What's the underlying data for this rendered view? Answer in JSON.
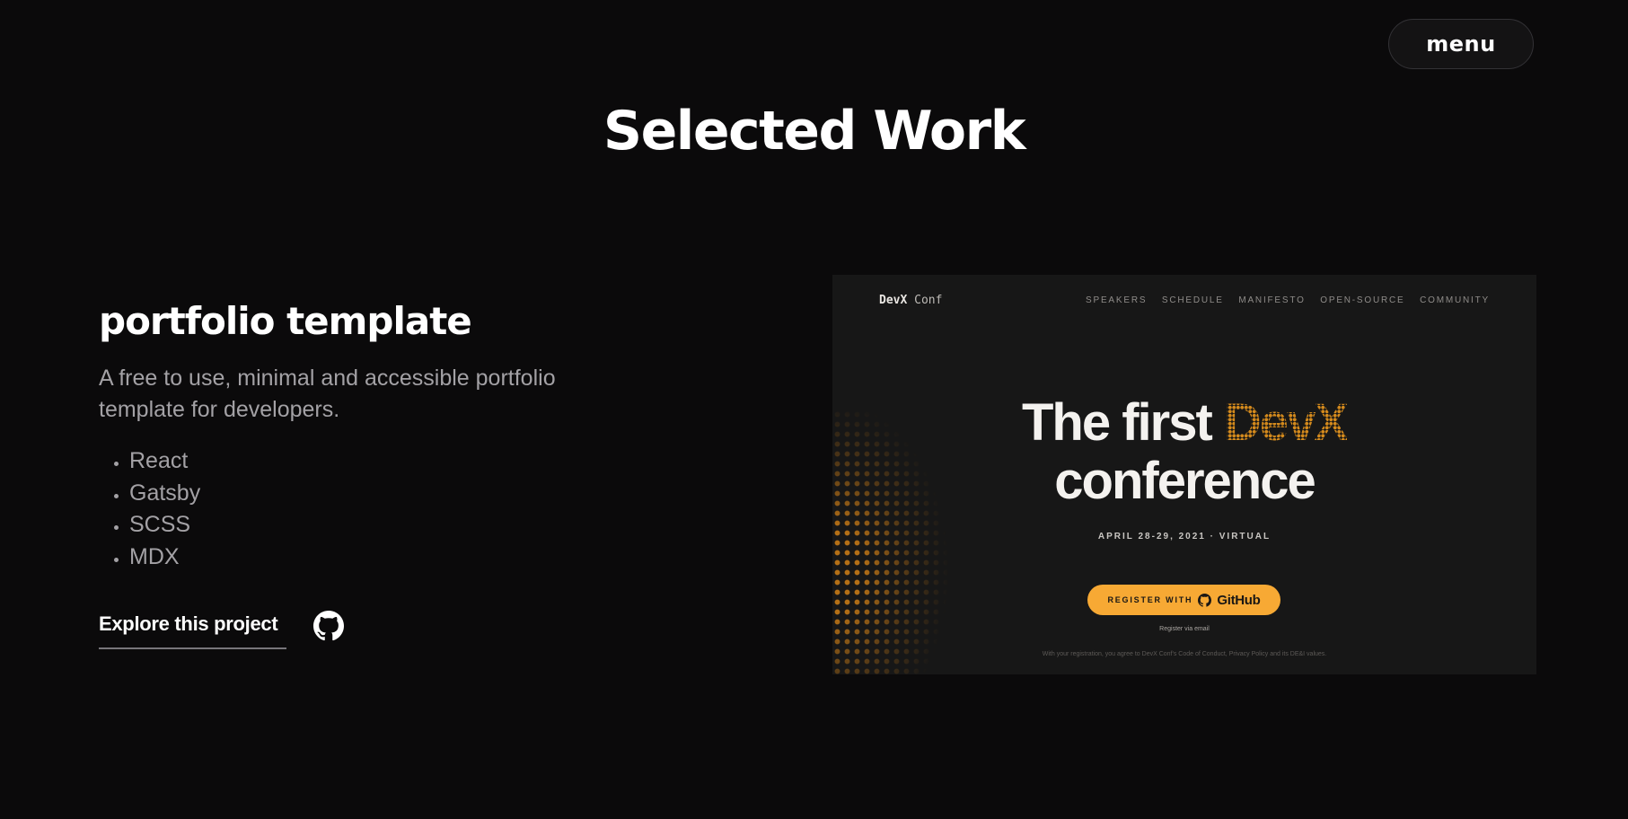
{
  "header": {
    "menu_label": "menu"
  },
  "page_title": "Selected Work",
  "project": {
    "name": "portfolio template",
    "description": "A free to use, minimal and accessible portfolio template for developers.",
    "tech": [
      "React",
      "Gatsby",
      "SCSS",
      "MDX"
    ],
    "explore_label": "Explore this project",
    "github_icon": "github-icon"
  },
  "preview": {
    "logo_bold": "DevX",
    "logo_rest": " Conf",
    "nav": [
      "SPEAKERS",
      "SCHEDULE",
      "MANIFESTO",
      "OPEN-SOURCE",
      "COMMUNITY"
    ],
    "hero_line1": "The first",
    "hero_accent": "DevX",
    "hero_line2": "conference",
    "dates": "APRIL 28-29, 2021 · VIRTUAL",
    "register_label": "REGISTER WITH",
    "register_brand": "GitHub",
    "email_link": "Register via email",
    "legal": "With your registration, you agree to DevX Conf's Code of Conduct, Privacy Policy and its DE&I values.",
    "accent_color": "#f7a934"
  },
  "colors": {
    "background": "#0b0a0b",
    "muted_text": "#a3a1a5"
  }
}
